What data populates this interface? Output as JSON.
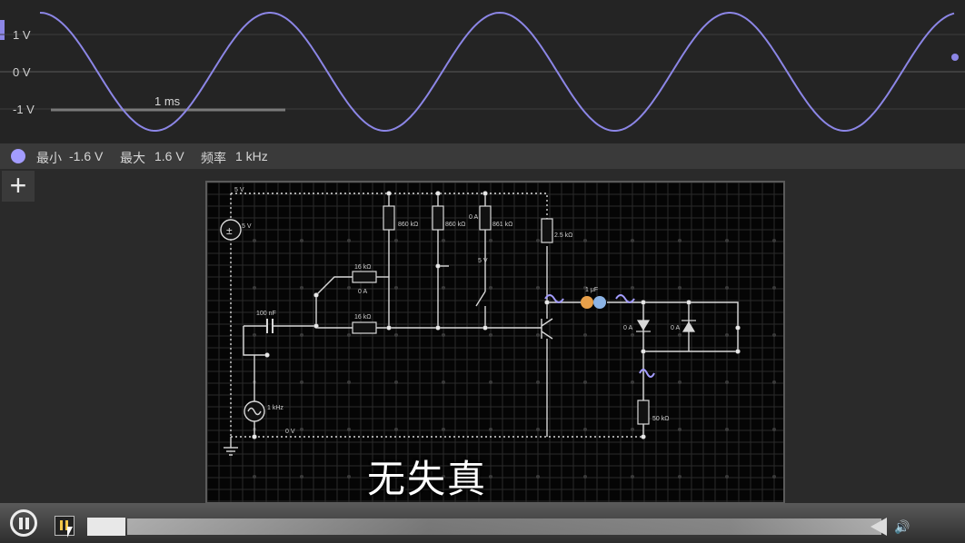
{
  "oscilloscope": {
    "y_labels": [
      "1 V",
      "0 V",
      "-1 V"
    ],
    "time_scale_label": "1 ms",
    "trace_color": "#8c86e6"
  },
  "stats": {
    "min_label": "最小",
    "min_value": "-1.6 V",
    "max_label": "最大",
    "max_value": "1.6 V",
    "freq_label": "频率",
    "freq_value": "1 kHz"
  },
  "toolbar": {
    "add_label": "+"
  },
  "circuit": {
    "supply_rail_label": "5 V",
    "ground_rail_label": "0 V",
    "dc_source_label": "5 V",
    "ac_source_label": "1 kHz",
    "input_capacitor_label": "100 nF",
    "resistor_top_label": "16 kΩ",
    "resistor_top_current": "0 A",
    "resistor_bottom_label": "16 kΩ",
    "resistor_1_label": "860 kΩ",
    "resistor_2_label": "860 kΩ",
    "resistor_3_label": "861 kΩ",
    "resistor_3_current": "0 A",
    "collector_resistor_label": "2.5 kΩ",
    "switch_5v_label": "5 V",
    "output_capacitor_label": "1 μF",
    "diode_1_current": "0 A",
    "diode_2_current": "0 A",
    "load_resistor_label": "50 kΩ"
  },
  "subtitle": "无失真",
  "player": {
    "play_pause_icon": "pause-circle-icon",
    "volume_icon": "speaker-icon"
  }
}
